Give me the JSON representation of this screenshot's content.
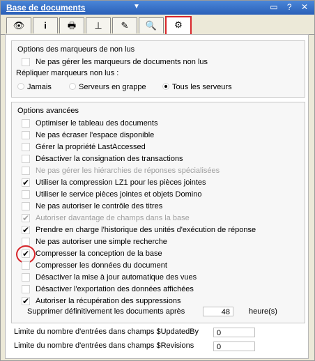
{
  "window": {
    "title": "Base de documents",
    "title_caret": "▼",
    "controls": [
      "▭",
      "?",
      "✕"
    ]
  },
  "tabs": [
    {
      "icon": "eye-icon",
      "glyph": "👁"
    },
    {
      "icon": "info-icon",
      "glyph": "i"
    },
    {
      "icon": "printer-icon",
      "glyph": "🖶"
    },
    {
      "icon": "design-icon",
      "glyph": "⊥"
    },
    {
      "icon": "pen-icon",
      "glyph": "✎"
    },
    {
      "icon": "search-icon",
      "glyph": "🔍"
    },
    {
      "icon": "advanced-icon",
      "glyph": "⚙",
      "active": true
    }
  ],
  "unread": {
    "title": "Options des marqueurs de non lus",
    "dont_manage": {
      "label": "Ne pas gérer les marqueurs de documents non lus",
      "checked": false
    },
    "replicate_label": "Répliquer marqueurs non lus :",
    "radios": [
      {
        "label": "Jamais",
        "selected": false
      },
      {
        "label": "Serveurs en grappe",
        "selected": false
      },
      {
        "label": "Tous les serveurs",
        "selected": true
      }
    ]
  },
  "advanced": {
    "title": "Options avancées",
    "options": [
      {
        "label": "Optimiser le tableau des documents",
        "checked": false,
        "disabled": false
      },
      {
        "label": "Ne pas écraser l'espace disponible",
        "checked": false,
        "disabled": false
      },
      {
        "label": "Gérer la propriété LastAccessed",
        "checked": false,
        "disabled": false
      },
      {
        "label": "Désactiver la consignation des transactions",
        "checked": false,
        "disabled": false
      },
      {
        "label": "Ne pas gérer les hiérarchies de réponses spécialisées",
        "checked": false,
        "disabled": true
      },
      {
        "label": "Utiliser la compression LZ1 pour les pièces jointes",
        "checked": true,
        "disabled": false
      },
      {
        "label": "Utiliser le service pièces jointes et objets Domino",
        "checked": false,
        "disabled": false
      },
      {
        "label": "Ne pas autoriser le contrôle des titres",
        "checked": false,
        "disabled": false
      },
      {
        "label": "Autoriser davantage de champs dans la base",
        "checked": true,
        "disabled": true
      },
      {
        "label": "Prendre en charge l'historique des unités d'exécution de réponse",
        "checked": true,
        "disabled": false
      },
      {
        "label": "Ne pas autoriser une simple recherche",
        "checked": false,
        "disabled": false
      },
      {
        "label": "Compresser la conception de la base",
        "checked": true,
        "disabled": false
      },
      {
        "label": "Compresser les données du document",
        "checked": false,
        "disabled": false
      },
      {
        "label": "Désactiver la mise à jour automatique des vues",
        "checked": false,
        "disabled": false
      },
      {
        "label": "Désactiver l'exportation des données affichées",
        "checked": false,
        "disabled": false
      },
      {
        "label": "Autoriser la récupération des suppressions",
        "checked": true,
        "disabled": false
      }
    ],
    "delete_label": "Supprimer définitivement les documents après",
    "delete_value": "48",
    "delete_unit": "heure(s)"
  },
  "limits": {
    "updated_by_label": "Limite du nombre d'entrées dans champs $UpdatedBy",
    "updated_by_value": "0",
    "revisions_label": "Limite du nombre d'entrées dans champs $Revisions",
    "revisions_value": "0"
  },
  "check_glyph": "✔",
  "accent_color": "#d8252a"
}
